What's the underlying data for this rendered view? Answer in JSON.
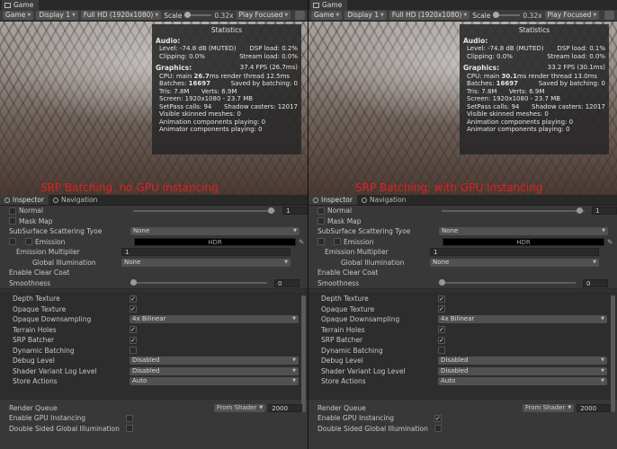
{
  "left": {
    "tab_title": "Game",
    "display": "Display 1",
    "resolution": "Full HD (1920x1080)",
    "scale_label": "Scale",
    "scale_value": "0.32x",
    "play_mode": "Play Focused",
    "stats": {
      "title": "Statistics",
      "audio_header": "Audio:",
      "level": "Level: -74.8 dB (MUTED)",
      "dsp": "DSP load: 0.2%",
      "clipping": "Clipping: 0.0%",
      "stream": "Stream load: 0.0%",
      "graphics_header": "Graphics:",
      "fps": "37.4 FPS (26.7ms)",
      "cpu_prefix": "CPU: main",
      "cpu_main": "26.7",
      "cpu_suffix": "ms  render thread 12.5ms",
      "batches_prefix": "Batches:",
      "batches": "16697",
      "saved": "Saved by batching: 0",
      "tris": "Tris: 7.8M",
      "verts": "Verts: 6.9M",
      "screen": "Screen: 1920x1080 - 23.7 MB",
      "setpass": "SetPass calls: 94",
      "shadow": "Shadow casters: 12017",
      "skinned": "Visible skinned meshes: 0",
      "anim": "Animation components playing: 0",
      "animator": "Animator components playing: 0"
    },
    "caption": "SRP Batching, no GPU Instancing",
    "gpu_instancing_checked": false
  },
  "right": {
    "tab_title": "Game",
    "display": "Display 1",
    "resolution": "Full HD (1920x1080)",
    "scale_label": "Scale",
    "scale_value": "0.32x",
    "play_mode": "Play Focused",
    "stats": {
      "title": "Statistics",
      "audio_header": "Audio:",
      "level": "Level: -74.8 dB (MUTED)",
      "dsp": "DSP load: 0.1%",
      "clipping": "Clipping: 0.0%",
      "stream": "Stream load: 0.0%",
      "graphics_header": "Graphics:",
      "fps": "33.2 FPS (30.1ms)",
      "cpu_prefix": "CPU: main",
      "cpu_main": "30.1",
      "cpu_suffix": "ms  render thread 13.0ms",
      "batches_prefix": "Batches:",
      "batches": "16697",
      "saved": "Saved by batching: 0",
      "tris": "Tris: 7.8M",
      "verts": "Verts: 6.9M",
      "screen": "Screen: 1920x1080 - 23.7 MB",
      "setpass": "SetPass calls: 94",
      "shadow": "Shadow casters: 12017",
      "skinned": "Visible skinned meshes: 0",
      "anim": "Animation components playing: 0",
      "animator": "Animator components playing: 0"
    },
    "caption": "SRP Batching, with GPU Instancing",
    "gpu_instancing_checked": true
  },
  "inspector": {
    "tab_inspector": "Inspector",
    "tab_navigation": "Navigation",
    "normal": "Normal",
    "normal_value": "1",
    "mask_map": "Mask Map",
    "subsurface_label": "SubSurface Scattering Tyoe",
    "subsurface_value": "None",
    "emission": "Emission",
    "hdr": "HDR",
    "emission_multiplier": "Emission Multiplier",
    "emission_multiplier_value": "1",
    "global_illumination": "Global Illumination",
    "global_illumination_value": "None",
    "enable_clear_coat": "Enable Clear Coat",
    "smoothness": "Smoothness",
    "smoothness_value": "0",
    "depth_texture": "Depth Texture",
    "opaque_texture": "Opaque Texture",
    "opaque_downsampling": "Opaque Downsampling",
    "opaque_downsampling_value": "4x Bilinear",
    "terrain_holes": "Terrain Holes",
    "srp_batcher": "SRP Batcher",
    "dynamic_batching": "Dynamic Batching",
    "debug_level": "Debug Level",
    "debug_level_value": "Disabled",
    "shader_variant": "Shader Variant Log Level",
    "shader_variant_value": "Disabled",
    "store_actions": "Store Actions",
    "store_actions_value": "Auto",
    "render_queue": "Render Queue",
    "render_queue_mode": "From Shader",
    "render_queue_value": "2000",
    "enable_gpu_instancing": "Enable GPU Instancing",
    "double_sided_gi": "Double Sided Global Illumination",
    "check_mark": "✓"
  }
}
